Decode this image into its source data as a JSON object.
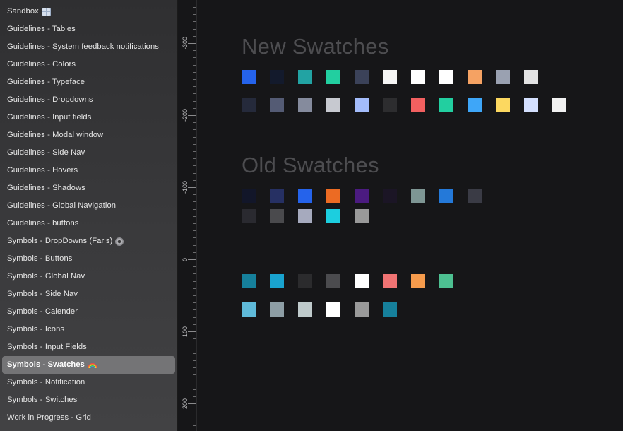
{
  "sidebar": {
    "pages": [
      {
        "label": "Sandbox",
        "icon": "grid-emoji"
      },
      {
        "label": "Guidelines - Tables"
      },
      {
        "label": "Guidelines - System feedback notifications"
      },
      {
        "label": "Guidelines - Colors"
      },
      {
        "label": "Guidelines - Typeface"
      },
      {
        "label": "Guidelines - Dropdowns"
      },
      {
        "label": "Guidelines - Input fields"
      },
      {
        "label": "Guidelines - Modal window"
      },
      {
        "label": "Guidelines - Side Nav"
      },
      {
        "label": "Guidelines - Hovers"
      },
      {
        "label": "Guidelines - Shadows"
      },
      {
        "label": "Guidelines - Global Navigation"
      },
      {
        "label": "Guidelines - buttons"
      },
      {
        "label": "Symbols - DropDowns (Faris)",
        "icon": "gear-emoji"
      },
      {
        "label": "Symbols - Buttons"
      },
      {
        "label": "Symbols - Global Nav"
      },
      {
        "label": "Symbols - Side Nav"
      },
      {
        "label": "Symbols - Calender"
      },
      {
        "label": "Symbols - Icons"
      },
      {
        "label": "Symbols - Input Fields"
      },
      {
        "label": "Symbols - Swatches",
        "icon": "rainbow-emoji",
        "selected": true
      },
      {
        "label": "Symbols - Notification"
      },
      {
        "label": "Symbols - Switches"
      },
      {
        "label": "Work in Progress - Grid"
      }
    ]
  },
  "ruler": {
    "labels": [
      "-300",
      "-200",
      "-100",
      "0",
      "100",
      "200"
    ]
  },
  "canvas": {
    "new_heading": "New Swatches",
    "old_heading": "Old Swatches",
    "new_swatches": [
      [
        "#2563eb",
        "#131a2c",
        "#22a3a3",
        "#22cfa0",
        "#3b4259",
        "#f5f5f5",
        "#ffffff",
        "#ffffff",
        "#f5a263",
        "#9aa1b1",
        "#e3e3e3"
      ],
      [
        "#252a3b",
        "#545b74",
        "#858b9d",
        "#c7c9d0",
        "#a3bcfb",
        "#2d2d2f",
        "#f26060",
        "#22cfa0",
        "#3ea6f8",
        "#fcd860",
        "#d4e0fe",
        "#f1f1f1"
      ]
    ],
    "old_swatches": [
      [
        "#121629",
        "#263063",
        "#2563eb",
        "#ec6b23",
        "#4b1b80",
        "#1b1525",
        "#7e9694",
        "#2479d9",
        "#3a3b45"
      ],
      [
        "#2a2a30",
        "#4a4a4d",
        "#a6aabe",
        "#1ccedf",
        "#999999"
      ]
    ],
    "extra_swatches": [
      [
        "#16809b",
        "#19a3cf",
        "#2b2b2d",
        "#4b4b4e",
        "#ffffff",
        "#f07373",
        "#f69b4c",
        "#4dc091"
      ],
      [
        "#5fbad9",
        "#8e9ea5",
        "#bfcacb",
        "#ffffff",
        "#9a9a9a",
        "#16809b"
      ]
    ]
  }
}
